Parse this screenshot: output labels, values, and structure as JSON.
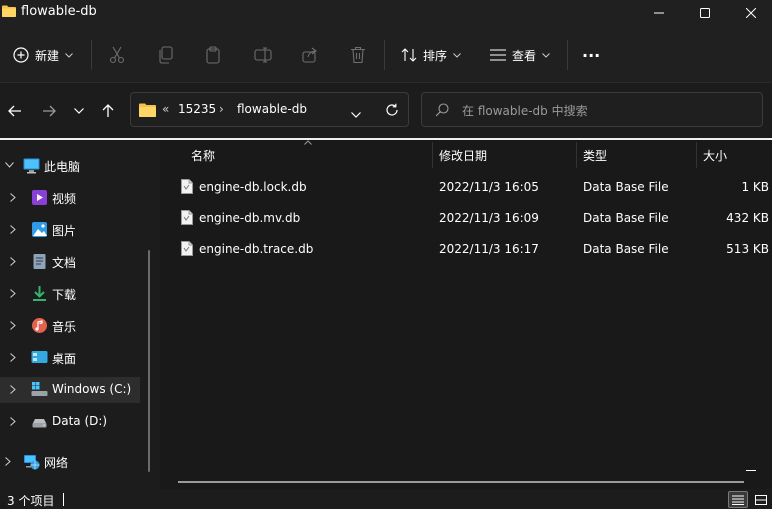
{
  "window": {
    "title": "flowable-db",
    "minimize_icon": "minimize-icon",
    "maximize_icon": "maximize-icon",
    "close_icon": "close-icon"
  },
  "toolbar": {
    "new_label": "新建",
    "sort_label": "排序",
    "view_label": "查看",
    "more_label": "···"
  },
  "address": {
    "overflow": "«",
    "crumbs": [
      "15235",
      "flowable-db"
    ],
    "separator": "›"
  },
  "search": {
    "placeholder": "在 flowable-db 中搜索"
  },
  "sidebar": {
    "items": [
      {
        "label": "此电脑",
        "icon": "computer-icon"
      },
      {
        "label": "视频",
        "icon": "video-icon"
      },
      {
        "label": "图片",
        "icon": "pictures-icon"
      },
      {
        "label": "文档",
        "icon": "documents-icon"
      },
      {
        "label": "下载",
        "icon": "download-icon"
      },
      {
        "label": "音乐",
        "icon": "music-icon"
      },
      {
        "label": "桌面",
        "icon": "desktop-icon"
      },
      {
        "label": "Windows (C:)",
        "icon": "drive-icon"
      },
      {
        "label": "Data (D:)",
        "icon": "drive-icon"
      },
      {
        "label": "网络",
        "icon": "network-icon"
      }
    ]
  },
  "columns": {
    "name": "名称",
    "modified": "修改日期",
    "type": "类型",
    "size": "大小"
  },
  "files": [
    {
      "name": "engine-db.lock.db",
      "modified": "2022/11/3 16:05",
      "type": "Data Base File",
      "size": "1 KB"
    },
    {
      "name": "engine-db.mv.db",
      "modified": "2022/11/3 16:09",
      "type": "Data Base File",
      "size": "432 KB"
    },
    {
      "name": "engine-db.trace.db",
      "modified": "2022/11/3 16:17",
      "type": "Data Base File",
      "size": "513 KB"
    }
  ],
  "status": {
    "item_count": "3 个项目"
  },
  "colors": {
    "background": "#1c1c1c",
    "folder_yellow": "#f8c24a",
    "accent_blue": "#4cc2ff"
  }
}
